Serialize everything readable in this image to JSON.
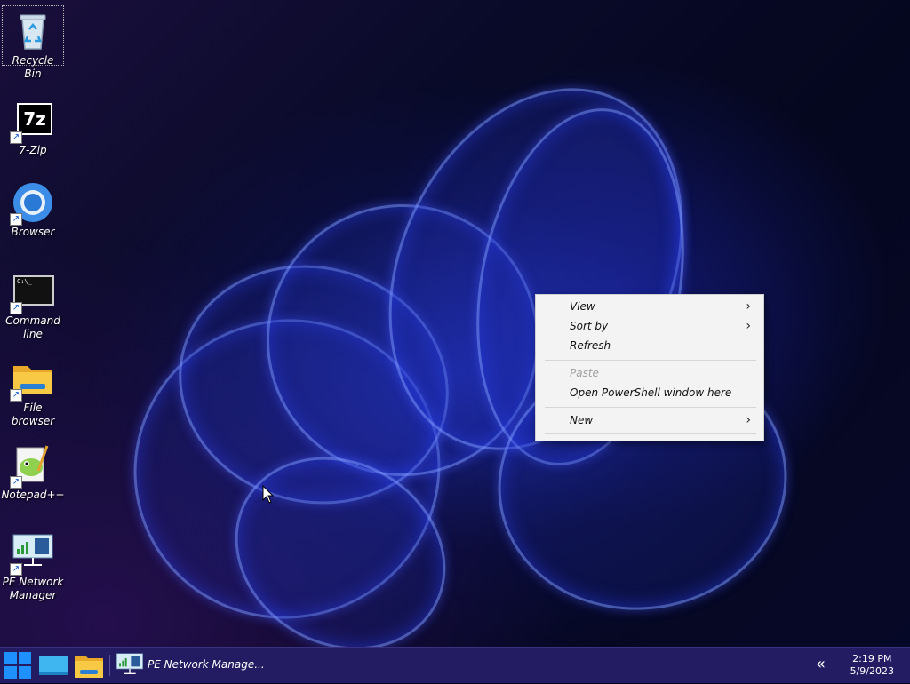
{
  "desktop": {
    "icons": [
      {
        "label": "Recycle Bin",
        "icon": "recycle-bin-icon"
      },
      {
        "label": "7-Zip",
        "icon": "seven-zip-icon"
      },
      {
        "label": "Browser",
        "icon": "browser-icon"
      },
      {
        "label": "Command line",
        "icon": "terminal-icon"
      },
      {
        "label": "File browser",
        "icon": "folder-icon"
      },
      {
        "label": "Notepad++",
        "icon": "notepad-plus-plus-icon"
      },
      {
        "label": "PE Network Manager",
        "icon": "network-manager-icon"
      }
    ],
    "seven_zip_glyph": "7z"
  },
  "context_menu": {
    "items": [
      {
        "label": "View",
        "submenu": true,
        "enabled": true
      },
      {
        "label": "Sort by",
        "submenu": true,
        "enabled": true
      },
      {
        "label": "Refresh",
        "submenu": false,
        "enabled": true
      },
      {
        "label": "Paste",
        "submenu": false,
        "enabled": false
      },
      {
        "label": "Open PowerShell window here",
        "submenu": false,
        "enabled": true
      },
      {
        "label": "New",
        "submenu": true,
        "enabled": true
      }
    ],
    "submenu_arrow": "›"
  },
  "taskbar": {
    "active_app_label": "PE Network Manage...",
    "overflow_glyph": "«",
    "clock": {
      "time": "2:19 PM",
      "date": "5/9/2023"
    }
  },
  "colors": {
    "taskbar": "#241c62",
    "start_accent": "#1e90ff",
    "menu_bg": "#f3f3f3"
  }
}
